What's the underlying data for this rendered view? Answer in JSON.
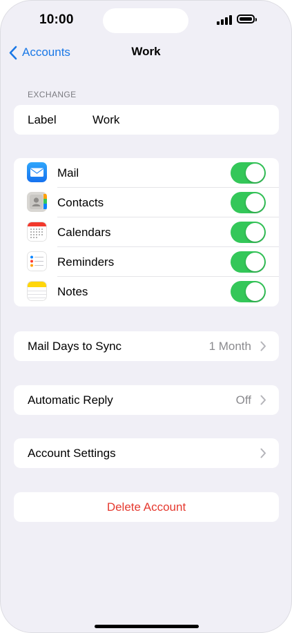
{
  "status_bar": {
    "time": "10:00"
  },
  "nav": {
    "back_label": "Accounts",
    "title": "Work"
  },
  "exchange": {
    "header": "EXCHANGE",
    "label_key": "Label",
    "label_value": "Work"
  },
  "sync": {
    "items": [
      {
        "label": "Mail",
        "icon": "mail-icon",
        "enabled": true
      },
      {
        "label": "Contacts",
        "icon": "contacts-icon",
        "enabled": true
      },
      {
        "label": "Calendars",
        "icon": "calendar-icon",
        "enabled": true
      },
      {
        "label": "Reminders",
        "icon": "reminders-icon",
        "enabled": true
      },
      {
        "label": "Notes",
        "icon": "notes-icon",
        "enabled": true
      }
    ]
  },
  "mail_days": {
    "label": "Mail Days to Sync",
    "value": "1 Month"
  },
  "auto_reply": {
    "label": "Automatic Reply",
    "value": "Off"
  },
  "account_settings": {
    "label": "Account Settings"
  },
  "delete_account": {
    "label": "Delete Account"
  },
  "colors": {
    "accent": "#1a78e6",
    "toggle_on": "#34c759",
    "destructive": "#e5392f",
    "background": "#f0eff6"
  }
}
